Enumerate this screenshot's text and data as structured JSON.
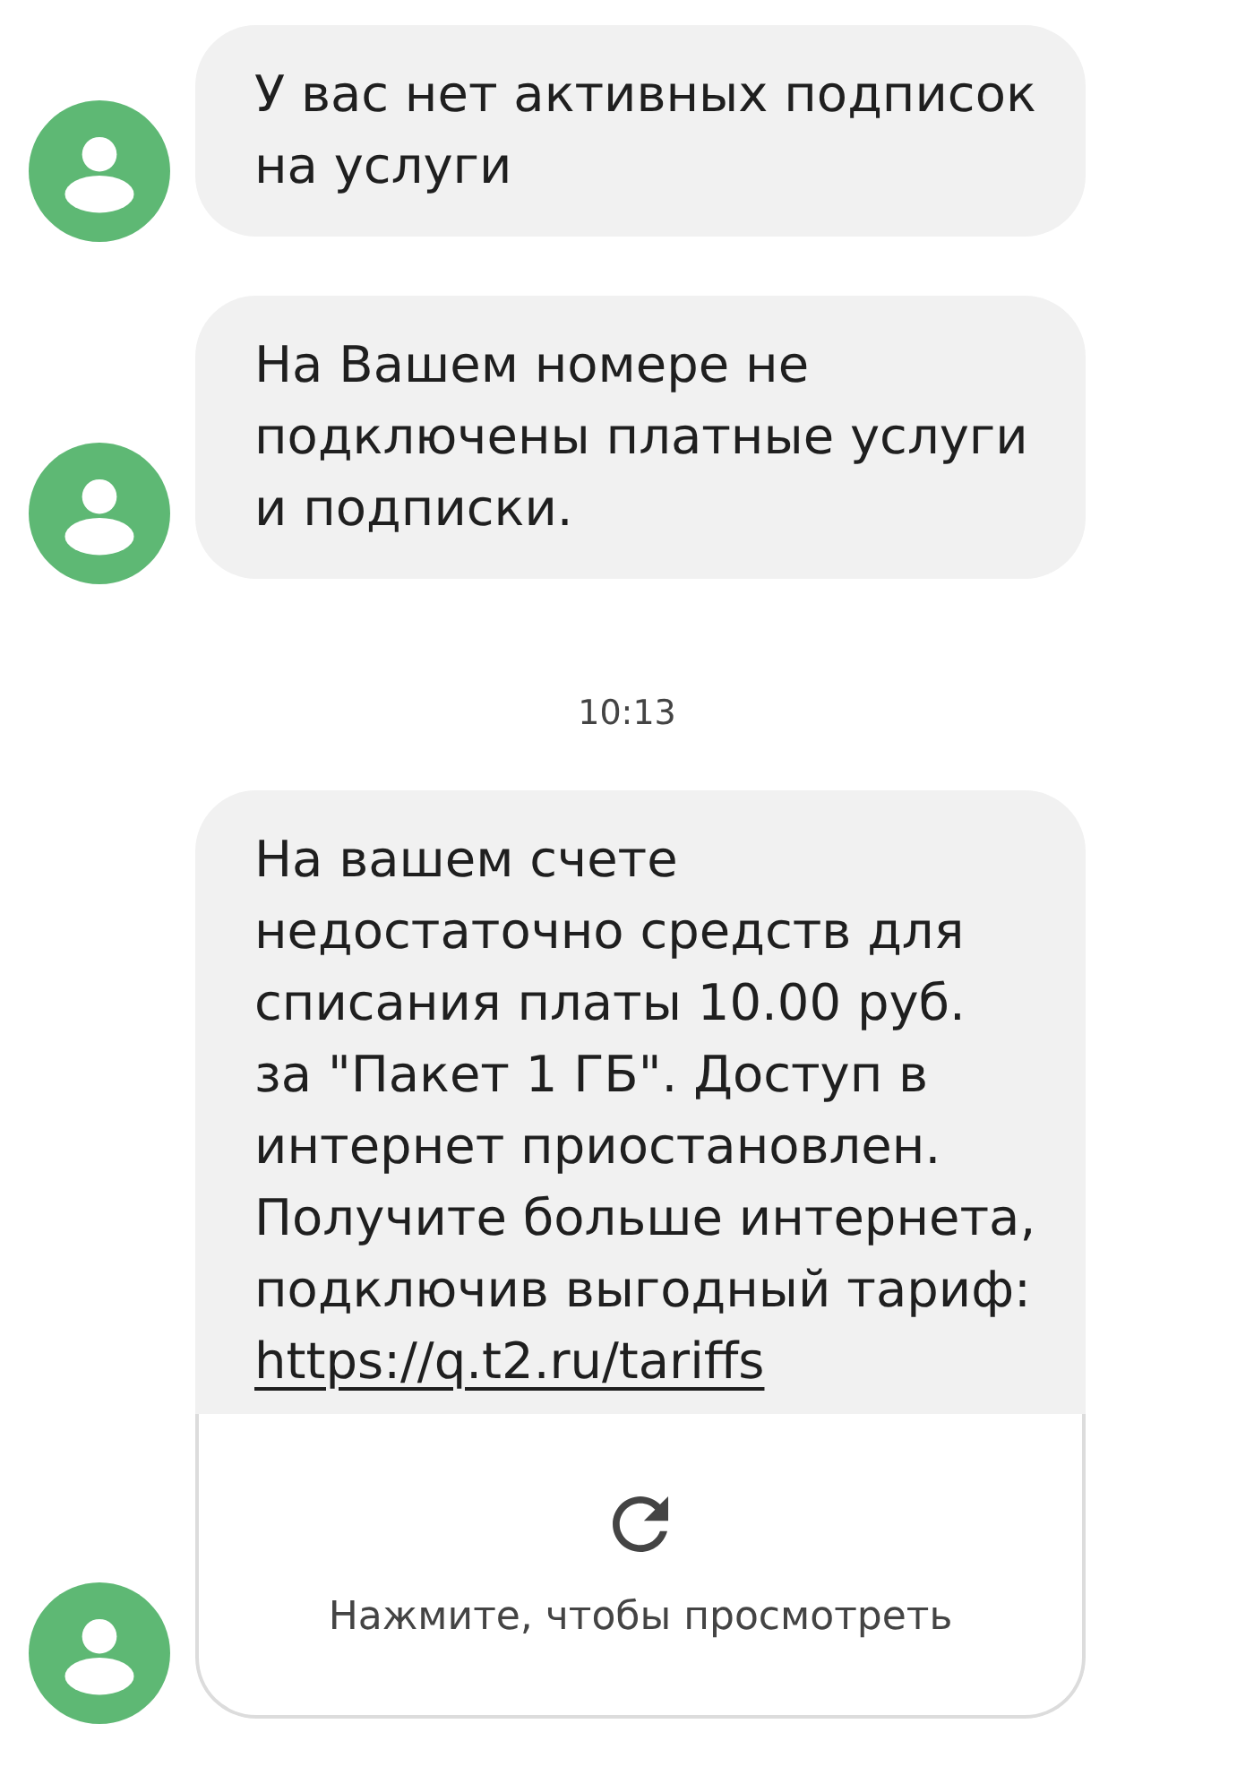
{
  "conversation": [
    {
      "kind": "message",
      "text": "У вас нет активных подписок\nна услуги"
    },
    {
      "kind": "message",
      "text": "На Вашем номере не\nподключены платные услуги\nи подписки."
    },
    {
      "kind": "timestamp",
      "text": "10:13"
    },
    {
      "kind": "message",
      "text": "На вашем счете\nнедостаточно средств для\nсписания платы 10.00 руб.\nза \"Пакет 1 ГБ\". Доступ в\nинтернет приостановлен.\nПолучите больше интернета,\nподключив выгодный тариф:",
      "link": "https://q.t2.ru/tariffs",
      "preview": {
        "caption": "Нажмите, чтобы просмотреть"
      }
    }
  ]
}
